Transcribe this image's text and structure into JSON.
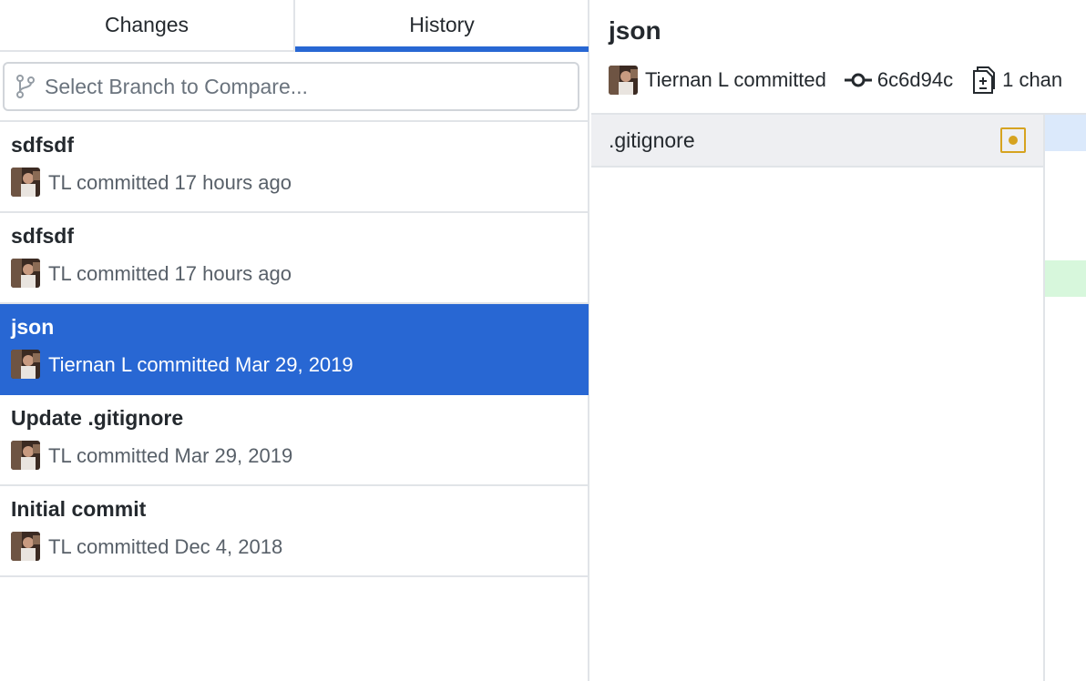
{
  "tabs": [
    {
      "label": "Changes",
      "selected": false
    },
    {
      "label": "History",
      "selected": true
    }
  ],
  "compare": {
    "placeholder": "Select Branch to Compare...",
    "icon": "git-branch-icon"
  },
  "commits": [
    {
      "summary": "sdfsdf",
      "meta": "TL committed 17 hours ago",
      "selected": false
    },
    {
      "summary": "sdfsdf",
      "meta": "TL committed 17 hours ago",
      "selected": false
    },
    {
      "summary": "json",
      "meta": "Tiernan L committed Mar 29, 2019",
      "selected": true
    },
    {
      "summary": "Update .gitignore",
      "meta": "TL committed Mar 29, 2019",
      "selected": false
    },
    {
      "summary": "Initial commit",
      "meta": "TL committed Dec 4, 2018",
      "selected": false
    }
  ],
  "selected_commit": {
    "title": "json",
    "author_text": "Tiernan L committed",
    "sha": "6c6d94c",
    "files_changed_text": "1 chan",
    "sha_icon": "git-commit-icon",
    "files_icon": "diff-file-icon"
  },
  "files": [
    {
      "path": ".gitignore",
      "status": "modified"
    }
  ],
  "colors": {
    "accent": "#2867d3",
    "modified": "#d6a320",
    "diff_hunk": "#dbe9fb",
    "diff_add": "#d7f7dc"
  }
}
